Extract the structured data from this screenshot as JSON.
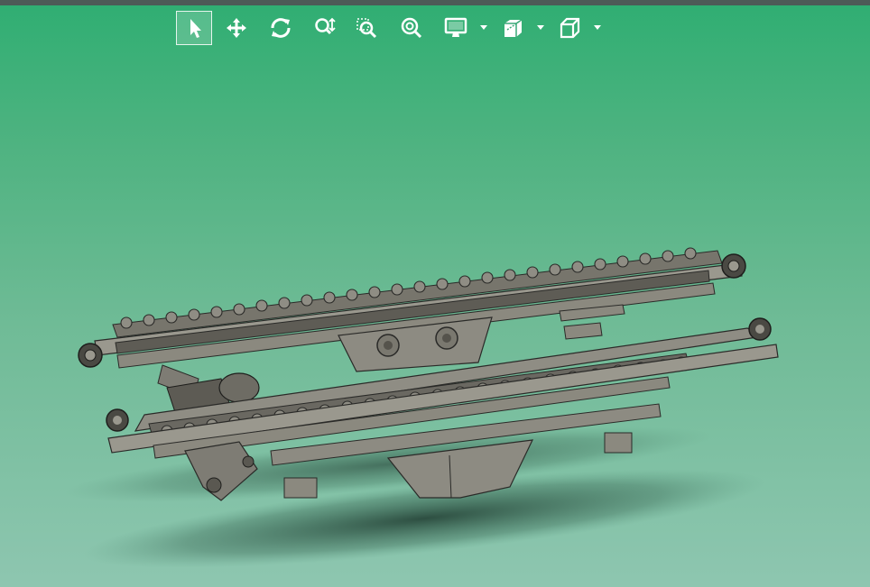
{
  "toolbar": {
    "buttons": [
      {
        "id": "select",
        "icon": "select-arrow-icon",
        "active": true
      },
      {
        "id": "pan",
        "icon": "pan-move-icon",
        "active": false
      },
      {
        "id": "rotate",
        "icon": "rotate-icon",
        "active": false
      },
      {
        "id": "zoom",
        "icon": "zoom-in-out-icon",
        "active": false
      },
      {
        "id": "zoom-window",
        "icon": "zoom-window-icon",
        "active": false
      },
      {
        "id": "zoom-fit",
        "icon": "zoom-fit-icon",
        "active": false
      },
      {
        "id": "display",
        "icon": "display-monitor-icon",
        "active": false,
        "dropdown": true
      },
      {
        "id": "section",
        "icon": "section-view-icon",
        "active": false,
        "dropdown": true
      },
      {
        "id": "view-orientation",
        "icon": "view-cube-icon",
        "active": false,
        "dropdown": true
      }
    ],
    "icon_color": "#ffffff"
  },
  "viewport": {
    "background_top": "#2fae72",
    "background_bottom": "#8ec6b0",
    "model": "conveyor-assembly-3d",
    "model_color": "#8f8d84"
  }
}
